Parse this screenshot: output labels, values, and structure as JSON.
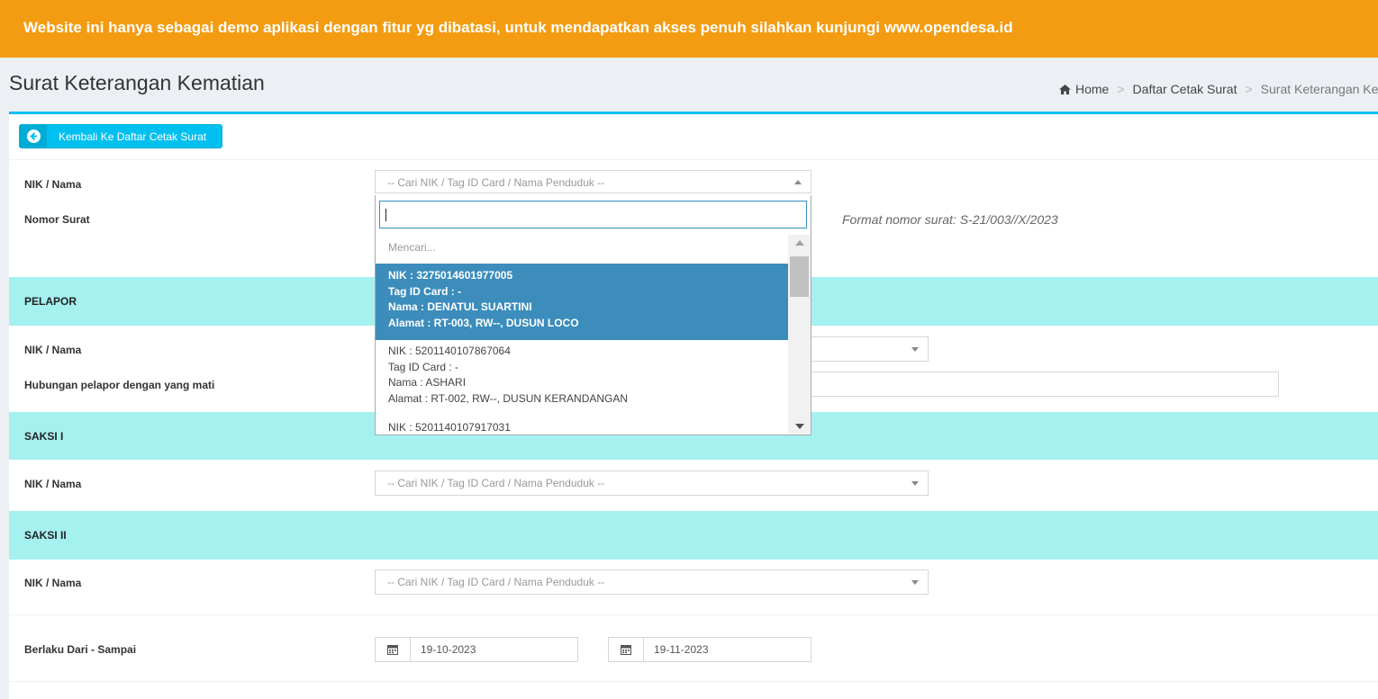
{
  "banner": {
    "text": "Website ini hanya sebagai demo aplikasi dengan fitur yg dibatasi, untuk mendapatkan akses penuh silahkan kunjungi www.opendesa.id"
  },
  "header": {
    "title": "Surat Keterangan Kematian"
  },
  "breadcrumb": {
    "home": "Home",
    "list": "Daftar Cetak Surat",
    "current": "Surat Keterangan Kematian"
  },
  "back_button": {
    "label": "Kembali Ke Daftar Cetak Surat"
  },
  "form": {
    "nik_label": "NIK / Nama",
    "nik_placeholder": "-- Cari NIK / Tag ID Card / Nama Penduduk --",
    "nomor_label": "Nomor Surat",
    "nomor_hint": "Format nomor surat: S-21/003//X/2023"
  },
  "dropdown": {
    "search_value": "",
    "status": "Mencari...",
    "options": [
      {
        "nik": "NIK : 3275014601977005",
        "tag": "Tag ID Card : -",
        "nama": "Nama : DENATUL SUARTINI",
        "alamat": "Alamat : RT-003, RW--, DUSUN LOCO"
      },
      {
        "nik": "NIK : 5201140107867064",
        "tag": "Tag ID Card : -",
        "nama": "Nama : ASHARI",
        "alamat": "Alamat : RT-002, RW--, DUSUN KERANDANGAN"
      },
      {
        "nik": "NIK : 5201140107917031",
        "tag": "",
        "nama": "",
        "alamat": ""
      }
    ]
  },
  "pelapor": {
    "heading": "PELAPOR",
    "nik_label": "NIK / Nama",
    "hubungan_label": "Hubungan pelapor dengan yang mati"
  },
  "saksi1": {
    "heading": "SAKSI I",
    "nik_label": "NIK / Nama",
    "placeholder": "-- Cari NIK / Tag ID Card / Nama Penduduk --"
  },
  "saksi2": {
    "heading": "SAKSI II",
    "nik_label": "NIK / Nama",
    "placeholder": "-- Cari NIK / Tag ID Card / Nama Penduduk --"
  },
  "berlaku": {
    "label": "Berlaku Dari - Sampai",
    "from": "19-10-2023",
    "to": "19-11-2023"
  },
  "colors": {
    "banner": "#f39c12",
    "accent": "#00c0ef",
    "section": "#a4f1f0",
    "selected": "#3c8dbc"
  }
}
